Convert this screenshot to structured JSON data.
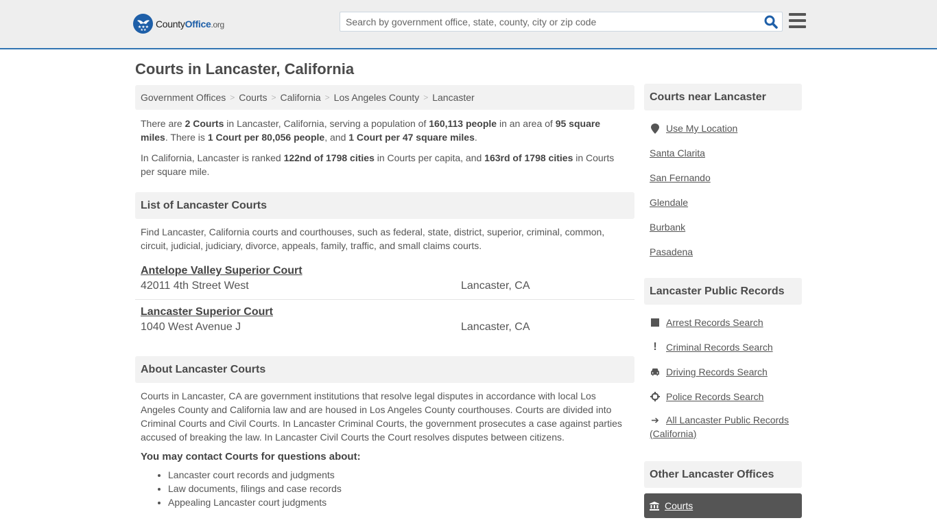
{
  "header": {
    "logo": {
      "part1": "County",
      "part2": "Office",
      "part3": ".org"
    },
    "search_placeholder": "Search by government office, state, county, city or zip code",
    "search_value": "",
    "accent_color": "#3174b2"
  },
  "page": {
    "title": "Courts in Lancaster, California"
  },
  "breadcrumb": [
    "Government Offices",
    "Courts",
    "California",
    "Los Angeles County",
    "Lancaster"
  ],
  "summary": {
    "p1": {
      "t1": "There are ",
      "b1": "2 Courts",
      "t2": " in Lancaster, California, serving a population of ",
      "b2": "160,113 people",
      "t3": " in an area of ",
      "b3": "95 square miles",
      "t4": ". There is ",
      "b4": "1 Court per 80,056 people",
      "t5": ", and ",
      "b5": "1 Court per 47 square miles",
      "t6": "."
    },
    "p2": {
      "t1": "In California, Lancaster is ranked ",
      "b1": "122nd of 1798 cities",
      "t2": " in Courts per capita, and ",
      "b2": "163rd of 1798 cities",
      "t3": " in Courts per square mile."
    }
  },
  "list_section": {
    "title": "List of Lancaster Courts",
    "intro": "Find Lancaster, California courts and courthouses, such as federal, state, district, superior, criminal, common, circuit, judicial, judiciary, divorce, appeals, family, traffic, and small claims courts.",
    "courts": [
      {
        "name": "Antelope Valley Superior Court",
        "address": "42011 4th Street West",
        "city": "Lancaster, CA"
      },
      {
        "name": "Lancaster Superior Court",
        "address": "1040 West Avenue J",
        "city": "Lancaster, CA"
      }
    ]
  },
  "about_section": {
    "title": "About Lancaster Courts",
    "body": "Courts in Lancaster, CA are government institutions that resolve legal disputes in accordance with local Los Angeles County and California law and are housed in Los Angeles County courthouses. Courts are divided into Criminal Courts and Civil Courts. In Lancaster Criminal Courts, the government prosecutes a case against parties accused of breaking the law. In Lancaster Civil Courts the Court resolves disputes between citizens.",
    "contact_heading": "You may contact Courts for questions about:",
    "bullets": [
      "Lancaster court records and judgments",
      "Law documents, filings and case records",
      "Appealing Lancaster court judgments"
    ]
  },
  "sidebar": {
    "nearby": {
      "title": "Courts near Lancaster",
      "use_location": "Use My Location",
      "cities": [
        "Santa Clarita",
        "San Fernando",
        "Glendale",
        "Burbank",
        "Pasadena"
      ]
    },
    "records": {
      "title": "Lancaster Public Records",
      "items": [
        {
          "label": "Arrest Records Search",
          "icon": "square-icon"
        },
        {
          "label": "Criminal Records Search",
          "icon": "exclamation-icon"
        },
        {
          "label": "Driving Records Search",
          "icon": "car-icon"
        },
        {
          "label": "Police Records Search",
          "icon": "crosshair-icon"
        },
        {
          "label": "All Lancaster Public Records (California)",
          "icon": "arrow-right-icon"
        }
      ]
    },
    "other": {
      "title": "Other Lancaster Offices",
      "active_item": "Courts"
    }
  }
}
